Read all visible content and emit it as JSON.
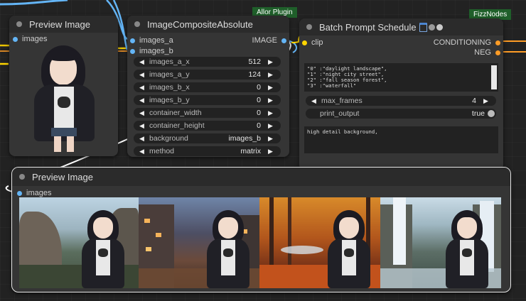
{
  "tags": {
    "allor": "Allor Plugin",
    "fizz": "FizzNodes"
  },
  "preview_top": {
    "title": "Preview Image",
    "input": "images"
  },
  "composite": {
    "title": "ImageCompositeAbsolute",
    "inputs": [
      "images_a",
      "images_b"
    ],
    "output": "IMAGE",
    "widgets": [
      {
        "label": "images_a_x",
        "value": "512"
      },
      {
        "label": "images_a_y",
        "value": "124"
      },
      {
        "label": "images_b_x",
        "value": "0"
      },
      {
        "label": "images_b_y",
        "value": "0"
      },
      {
        "label": "container_width",
        "value": "0"
      },
      {
        "label": "container_height",
        "value": "0"
      },
      {
        "label": "background",
        "value": "images_b"
      },
      {
        "label": "method",
        "value": "matrix"
      }
    ]
  },
  "batch": {
    "title": "Batch Prompt Schedule",
    "input": "clip",
    "outputs": [
      "CONDITIONING",
      "NEG"
    ],
    "schedule_text": "\"0\" :\"daylight landscape\",\n\"1\" :\"night city street\",\n\"2\" :\"fall season forest\",\n\"3\" :\"waterfall\"",
    "max_frames_label": "max_frames",
    "max_frames_value": "4",
    "print_output_label": "print_output",
    "print_output_value": "true",
    "prompt_text": "high detail background,"
  },
  "preview_bottom": {
    "title": "Preview Image",
    "input": "images"
  },
  "colors": {
    "node_bg": "#353535",
    "title_bg": "#2b2b2b",
    "image_slot": "#64b5f6",
    "clip_slot": "#ffd500",
    "conditioning_slot": "#ff9c26",
    "tag_green": "#1f5f2a"
  }
}
